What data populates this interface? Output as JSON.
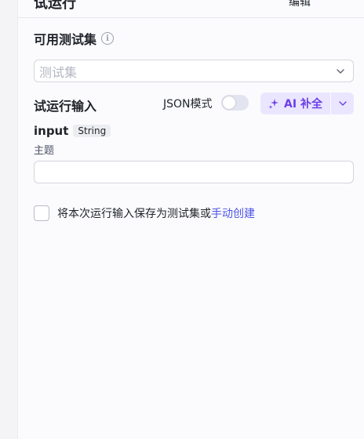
{
  "header": {
    "title": "试运行",
    "right_text": "编辑"
  },
  "test_sets": {
    "title": "可用测试集",
    "info_icon": "info-icon",
    "select_placeholder": "测试集"
  },
  "trial_input": {
    "label": "试运行输入",
    "json_mode_label": "JSON模式",
    "json_mode_on": false,
    "ai_button_label": "AI 补全",
    "accent_color": "#6c3ee8"
  },
  "field": {
    "name": "input",
    "type": "String",
    "description": "主题",
    "value": ""
  },
  "save": {
    "checked": false,
    "text": "将本次运行输入保存为测试集或",
    "link": "手动创建"
  }
}
